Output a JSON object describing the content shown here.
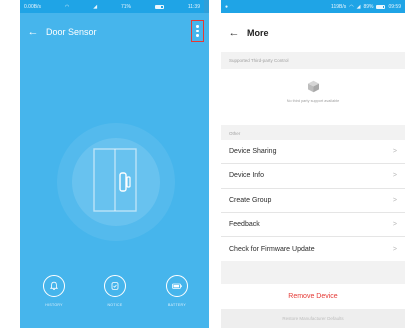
{
  "left": {
    "status_bar": {
      "speed": "0.00B/s",
      "battery": "71%",
      "time": "11:39"
    },
    "header": {
      "title": "Door Sensor"
    },
    "bottom": [
      {
        "label": "HISTORY"
      },
      {
        "label": "NOTICE"
      },
      {
        "label": "BATTERY"
      }
    ],
    "colors": {
      "background": "#46b5ec",
      "menu_highlight": "#e53935"
    }
  },
  "right": {
    "status_bar": {
      "speed": "119B/s",
      "battery": "89%",
      "time": "09:59"
    },
    "header": {
      "title": "More"
    },
    "third_party": {
      "section": "Supported Third-party Control",
      "note": "No third party support available"
    },
    "other_section": "Other",
    "items": [
      {
        "label": "Device Sharing",
        "chevron": ">"
      },
      {
        "label": "Device Info",
        "chevron": ">"
      },
      {
        "label": "Create Group",
        "chevron": ">"
      },
      {
        "label": "Feedback",
        "chevron": ">"
      },
      {
        "label": "Check for Firmware Update",
        "chevron": ">"
      }
    ],
    "remove": "Remove Device",
    "restore": "Restore Manufacturer Defaults",
    "colors": {
      "accent": "#1fa4e6",
      "danger": "#e53935"
    }
  }
}
